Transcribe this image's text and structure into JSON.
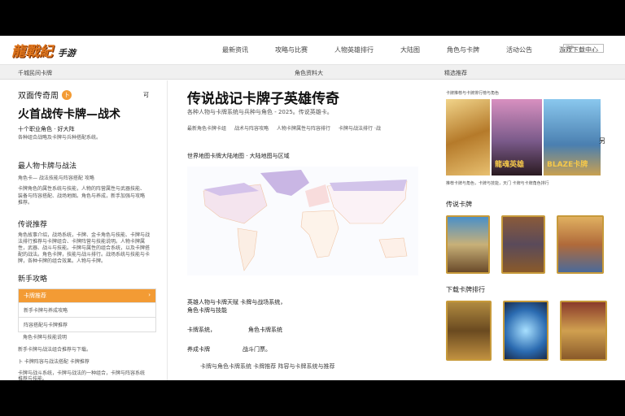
{
  "header": {
    "logo": "龍戰紀",
    "logo_sub": "手游",
    "nav": [
      "最新资讯",
      "攻略与比赛",
      "人物英雄排行",
      "大陆图",
      "角色与卡牌",
      "活动公告",
      "游戏下载中心"
    ],
    "search_placeholder": "搜索"
  },
  "subbar": {
    "left": "千城民间卡牌",
    "center": "角色资料大",
    "right": "精选推荐"
  },
  "left": {
    "brand": "双面传奇周",
    "brand_badge": "卜",
    "close": "可",
    "title": "火首战传卡牌—战术",
    "subtitle": "十个职业角色 · 好大阵",
    "desc": "各种组合战略及卡牌与兵种搭配系统。",
    "sec1": "最人物卡牌与战法",
    "sec1_line": "角色卡— 战法技能与阵容搭配 攻略",
    "sec1_p": "卡牌角色的属性系统与技能，人物的阵营属性与武器技能、装备与阵容搭配、战场地图。角色与养成，新手加强与攻略推荐。",
    "sec2": "传说推荐",
    "sec2_p": "角色故事介绍，战场系统，卡牌、金卡角色与技能、卡牌与战法排行推荐与卡牌组合、卡牌阵营与技能说明。人物卡牌属性，武器、战斗与技能。卡牌与属性的组合系统，以及卡牌搭配的战法。角色卡牌，技能与战斗排行。战场系统与技能与卡牌，各种卡牌的组合效果。人物与卡牌。",
    "sec3": "新手攻略",
    "accordion": {
      "head": "卡牌推荐",
      "rows": [
        "新手卡牌与养成攻略",
        "阵容搭配与卡牌推荐",
        "角色卡牌与技能说明"
      ]
    },
    "foot1": "新手卡牌与战法组合推荐与下载。",
    "foot2": "卜 卡牌阵容与战法搭配    卡牌推荐",
    "foot3": "卡牌与战斗系统，卡牌与战法的一种组合，卡牌与阵容系统推荐与技能。"
  },
  "center": {
    "title": "传说战记卡牌子英雄传奇",
    "subtitle": "各种人物与卡牌系统与兵种与角色 - 2025。传说英雄卡。",
    "meta": [
      "最新角色卡牌卡组",
      "战术与阵容攻略",
      "人物卡牌属性与阵容排行",
      "卡牌与战法排行 ·战"
    ],
    "map_title": "世界地图卡牌大陆地图 · 大陆地图与区域",
    "p1": "英雄人物与卡牌天赋  卡牌与战场系统，",
    "p1b": "角色卡牌与技能",
    "p2a": "卡牌系统，",
    "p2b": "角色卡牌系统",
    "p3a": "养成卡牌",
    "p3b": "战斗门票。",
    "footer": "卡牌与角色卡牌系统  卡牌推荐  阵容与卡牌系统与推荐"
  },
  "right": {
    "caption_top": "卡牌推荐与卡牌排行榜与角色",
    "banner_texts": [
      "龍魂英雄",
      "BLAZE卡牌"
    ],
    "side_char": "另",
    "caption": "推荐卡牌与角色，卡牌与技能，天门  卡牌与卡牌角色排行",
    "sec1": "传说卡牌",
    "sec2": "下载卡牌排行"
  },
  "colors": {
    "accent": "#f39b34",
    "card_border": "#c79a3a"
  }
}
